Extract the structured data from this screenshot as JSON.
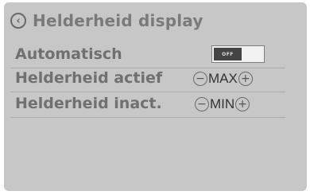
{
  "header": {
    "back_icon": "chevron-left-circle-icon",
    "title": "Helderheid display"
  },
  "rows": [
    {
      "label": "Automatisch",
      "toggle_state": "OFF"
    },
    {
      "label": "Helderheid actief",
      "value": "MAX",
      "minus": "−",
      "plus": "+"
    },
    {
      "label": "Helderheid inact.",
      "value": "MIN",
      "minus": "−",
      "plus": "+"
    }
  ]
}
